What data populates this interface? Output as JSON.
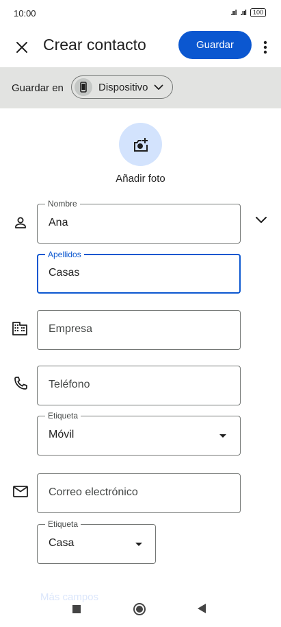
{
  "status_bar": {
    "time": "10:00",
    "signal1": ".ııl",
    "signal2": ".ııl",
    "battery": "100"
  },
  "app_bar": {
    "title": "Crear contacto",
    "save_label": "Guardar"
  },
  "save_in": {
    "label": "Guardar en",
    "account": "Dispositivo"
  },
  "photo": {
    "label": "Añadir foto"
  },
  "fields": {
    "first_name": {
      "label": "Nombre",
      "value": "Ana"
    },
    "last_name": {
      "label": "Apellidos",
      "value": "Casas"
    },
    "company": {
      "placeholder": "Empresa"
    },
    "phone": {
      "placeholder": "Teléfono"
    },
    "phone_label": {
      "label": "Etiqueta",
      "value": "Móvil"
    },
    "email": {
      "placeholder": "Correo electrónico"
    },
    "email_label": {
      "label": "Etiqueta",
      "value": "Casa"
    }
  },
  "more_fields": "Más campos",
  "colors": {
    "accent": "#0b57d0",
    "save_bar": "#e2e3e1",
    "photo_bg": "#d3e3fd"
  }
}
